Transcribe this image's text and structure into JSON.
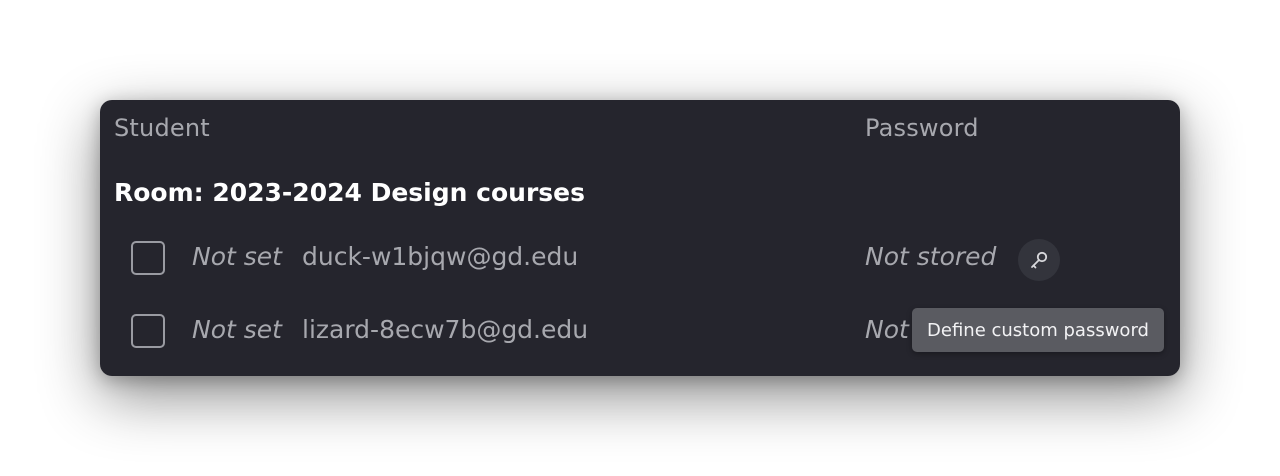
{
  "table": {
    "columns": {
      "student": "Student",
      "password": "Password"
    },
    "room_title": "Room: 2023-2024 Design courses",
    "rows": [
      {
        "name": "Not set",
        "email": "duck-w1bjqw@gd.edu",
        "password_status": "Not stored",
        "key_icon": "key-icon"
      },
      {
        "name": "Not set",
        "email": "lizard-8ecw7b@gd.edu",
        "password_status": "Not stored"
      }
    ]
  },
  "tooltip": {
    "text": "Define custom password"
  },
  "colors": {
    "panel_bg": "#25252d",
    "text_muted": "#a7a8ae",
    "text_strong": "#ffffff",
    "tooltip_bg": "#5a5b61"
  }
}
